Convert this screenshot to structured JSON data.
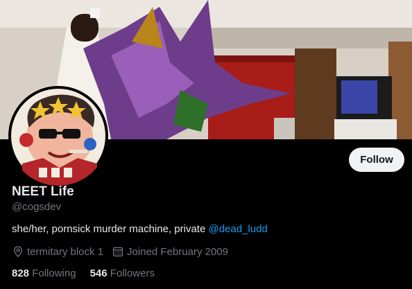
{
  "profile": {
    "display_name": "NEET Life",
    "handle": "@cogsdev",
    "bio_text": "she/her, pornsick murder machine, private ",
    "bio_mention": "@dead_ludd",
    "location": "termitary block 1",
    "joined": "Joined February 2009",
    "following_count": "828",
    "following_label": "Following",
    "followers_count": "546",
    "followers_label": "Followers"
  },
  "actions": {
    "follow_label": "Follow"
  },
  "icons": {
    "location": "location-pin-icon",
    "calendar": "calendar-icon"
  },
  "colors": {
    "accent": "#1d9bf0",
    "background": "#000000",
    "text": "#e7e9ea",
    "muted": "#71767b"
  }
}
